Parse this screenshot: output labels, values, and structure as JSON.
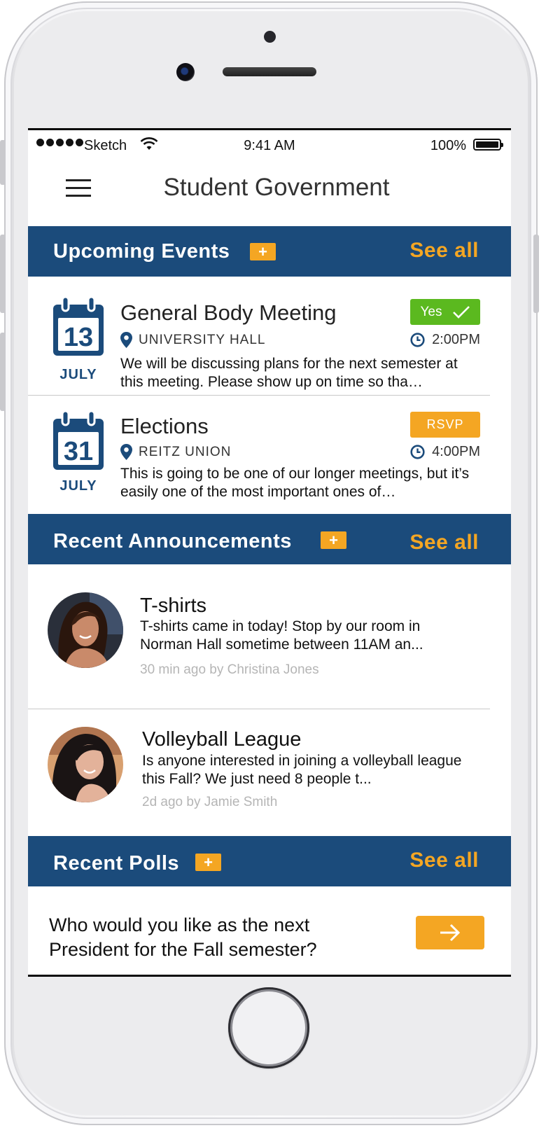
{
  "status_bar": {
    "carrier": "Sketch",
    "time": "9:41 AM",
    "battery": "100%"
  },
  "header": {
    "title": "Student Government"
  },
  "sections": {
    "events": {
      "title": "Upcoming Events",
      "add": "+",
      "see_all": "See all"
    },
    "announcements": {
      "title": "Recent Announcements",
      "add": "+",
      "see_all": "See all"
    },
    "polls": {
      "title": "Recent Polls",
      "add": "+",
      "see_all": "See all"
    }
  },
  "events": [
    {
      "day": "13",
      "month": "JULY",
      "title": "General Body Meeting",
      "location": "UNIVERSITY HALL",
      "time": "2:00PM",
      "description": "We will be discussing plans for the next semester at this meeting.  Please show up on time so tha…",
      "action": "Yes",
      "action_state": "confirmed"
    },
    {
      "day": "31",
      "month": "JULY",
      "title": "Elections",
      "location": "REITZ UNION",
      "time": "4:00PM",
      "description": "This is going to be one of our longer meetings, but it’s easily one of the most important ones of…",
      "action": "RSVP",
      "action_state": "pending"
    }
  ],
  "announcements": [
    {
      "title": "T-shirts",
      "body": "T-shirts came in today! Stop by our room in Norman Hall sometime between 11AM an...",
      "meta": "30 min ago by Christina Jones"
    },
    {
      "title": "Volleyball League",
      "body": "Is anyone interested in joining a volleyball league this Fall?  We just need 8 people t...",
      "meta": "2d  ago by Jamie Smith"
    }
  ],
  "poll": {
    "question": "Who would you like as the next President for the Fall semester?"
  },
  "colors": {
    "header_blue": "#1b4b7b",
    "accent_orange": "#f4a623",
    "confirm_green": "#5bb91f"
  },
  "icons": {
    "menu": "hamburger-icon",
    "calendar": "calendar-icon",
    "location": "location-pin-icon",
    "time": "clock-icon",
    "check": "checkmark-icon",
    "arrow": "arrow-right-icon"
  }
}
